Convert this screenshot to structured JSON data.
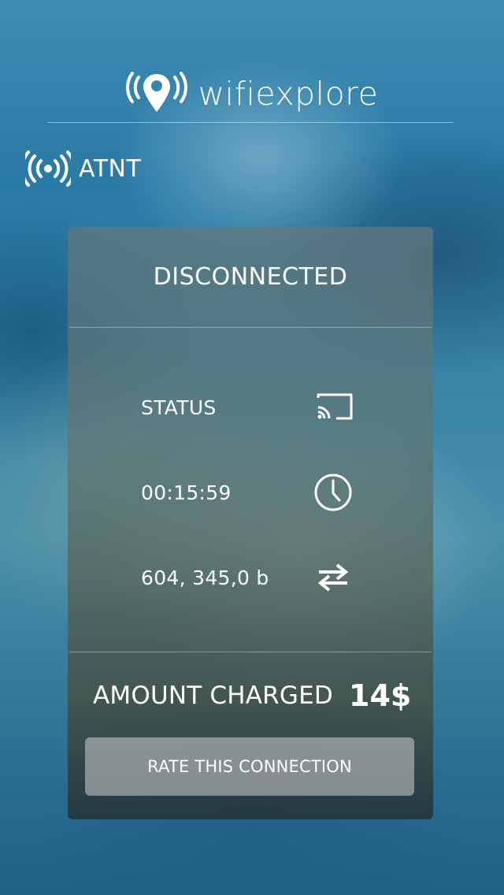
{
  "app": {
    "name": "wifiexplore",
    "logo_icon": "location-pin-wifi-icon"
  },
  "network": {
    "name": "ATNT",
    "icon": "wifi-signal-icon"
  },
  "connection": {
    "state": "DISCONNECTED",
    "rows": [
      {
        "label": "STATUS",
        "icon": "cast-icon"
      },
      {
        "label": "00:15:59",
        "icon": "clock-icon"
      },
      {
        "label": "604, 345,0 b",
        "icon": "transfer-arrows-icon"
      }
    ],
    "amount_label": "AMOUNT CHARGED",
    "amount_value": "14$",
    "rate_button": "RATE THIS CONNECTION"
  },
  "colors": {
    "text": "#ffffff",
    "background": "#2b6f93",
    "button": "#bebebe"
  }
}
